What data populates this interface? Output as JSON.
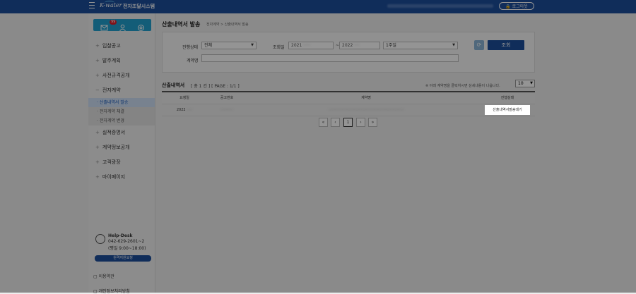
{
  "header": {
    "brand": "K-water",
    "system_name": "전자조달시스템",
    "logout_label": "로그아웃"
  },
  "sidebar": {
    "badge_count": "99",
    "menu": [
      {
        "label": "입찰공고"
      },
      {
        "label": "발주계획"
      },
      {
        "label": "사전규격공개"
      },
      {
        "label": "전자계약",
        "expanded": true
      }
    ],
    "submenu": [
      {
        "label": "산출내역서 발송",
        "active": true
      },
      {
        "label": "전자계약 체결"
      },
      {
        "label": "전자계약 변경"
      }
    ],
    "menu_after": [
      {
        "label": "실적증명서"
      },
      {
        "label": "계약정보공개"
      },
      {
        "label": "고객광장"
      },
      {
        "label": "마이페이지"
      }
    ],
    "helpdesk": {
      "title": "Help-Desk",
      "phone": "042-629-2601~2",
      "hours": "(평일 9:00~18:00)"
    },
    "remote_button": "원격지원요청",
    "link1": "이용약관",
    "link2": "개인정보처리방침"
  },
  "main": {
    "title": "산출내역서 발송",
    "breadcrumb": "전자계약 > 산출내역서 발송",
    "search": {
      "progress_label": "진행상태",
      "progress_value": "전체",
      "period_label": "조회일",
      "date_from": "2021",
      "date_to": "2022",
      "period_value": "1주일",
      "contract_label": "계약명",
      "refresh_icon": "refresh-icon",
      "search_button": "조회"
    },
    "list": {
      "title": "산출내역서",
      "count": "[ 총 1 건 ] [ PAGE : 1/1 ]",
      "note": "※ 아래 계약명을 클릭하시면 상세내용이 나옵니다.",
      "page_size": "10",
      "columns": [
        "요청일",
        "공고번호",
        "계약명",
        "진행상태"
      ],
      "rows": [
        {
          "date": "2022",
          "notice_no": "",
          "contract_name": "",
          "status": "산출내역서발송대기"
        }
      ]
    },
    "pager": {
      "first": "«",
      "prev": "‹",
      "current": "1",
      "next": "›",
      "last": "»"
    }
  }
}
